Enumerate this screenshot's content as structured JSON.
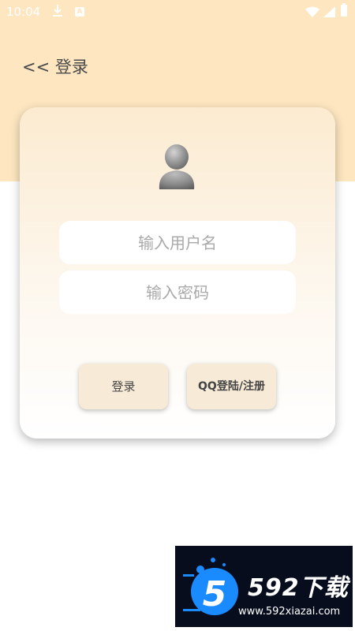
{
  "status_bar": {
    "time": "10:04",
    "notification_letter": "A"
  },
  "header": {
    "back_chevrons": "<<",
    "title": "登录"
  },
  "login_card": {
    "username_placeholder": "输入用户名",
    "password_placeholder": "输入密码",
    "login_button": "登录",
    "qq_button": "QQ登陆/注册"
  },
  "watermark": {
    "logo_text": "592下载",
    "url": "www.592xiazai.com"
  },
  "colors": {
    "header_background": "#fde6c0",
    "card_top": "#fcebd0",
    "button_background": "#f7ead7",
    "watermark_background": "#070d1c",
    "watermark_accent": "#1a8bff"
  }
}
